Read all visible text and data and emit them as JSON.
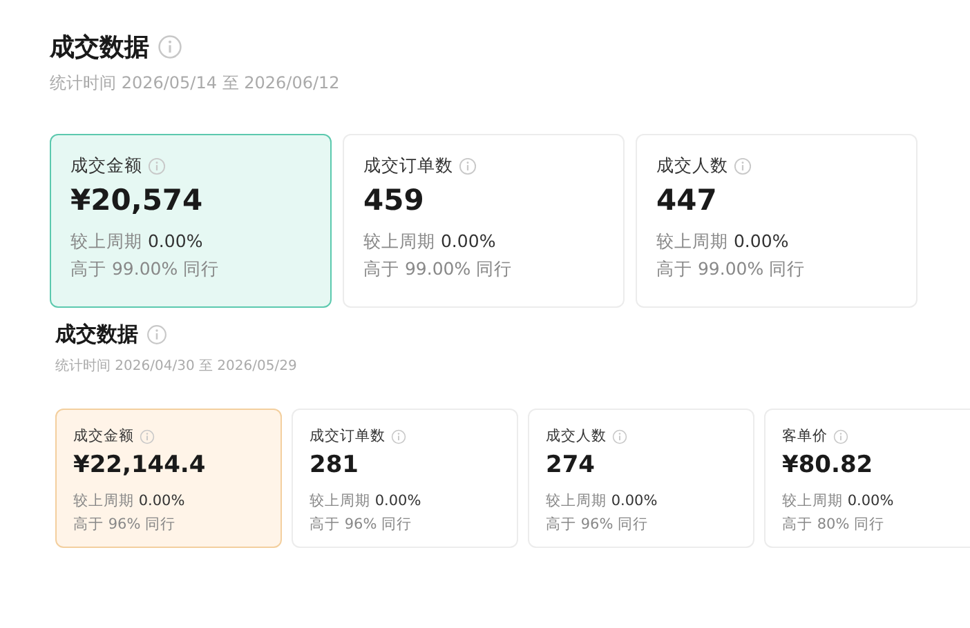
{
  "sections": [
    {
      "kind": "large",
      "title": "成交数据",
      "period": "统计时间 2026/05/14 至 2026/06/12",
      "cards": [
        {
          "label": "成交金额",
          "value": "¥20,574",
          "compare_label": "较上周期",
          "compare_value": "0.00%",
          "peer": "高于 99.00% 同行",
          "selected": true
        },
        {
          "label": "成交订单数",
          "value": "459",
          "compare_label": "较上周期",
          "compare_value": "0.00%",
          "peer": "高于 99.00% 同行",
          "selected": false
        },
        {
          "label": "成交人数",
          "value": "447",
          "compare_label": "较上周期",
          "compare_value": "0.00%",
          "peer": "高于 99.00% 同行",
          "selected": false
        }
      ]
    },
    {
      "kind": "small",
      "title": "成交数据",
      "period": "统计时间 2026/04/30 至 2026/05/29",
      "cards": [
        {
          "label": "成交金额",
          "value": "¥22,144.4",
          "compare_label": "较上周期",
          "compare_value": "0.00%",
          "peer": "高于 96% 同行",
          "selected": true
        },
        {
          "label": "成交订单数",
          "value": "281",
          "compare_label": "较上周期",
          "compare_value": "0.00%",
          "peer": "高于 96% 同行",
          "selected": false
        },
        {
          "label": "成交人数",
          "value": "274",
          "compare_label": "较上周期",
          "compare_value": "0.00%",
          "peer": "高于 96% 同行",
          "selected": false
        },
        {
          "label": "客单价",
          "value": "¥80.82",
          "compare_label": "较上周期",
          "compare_value": "0.00%",
          "peer": "高于 80% 同行",
          "selected": false
        }
      ]
    }
  ]
}
